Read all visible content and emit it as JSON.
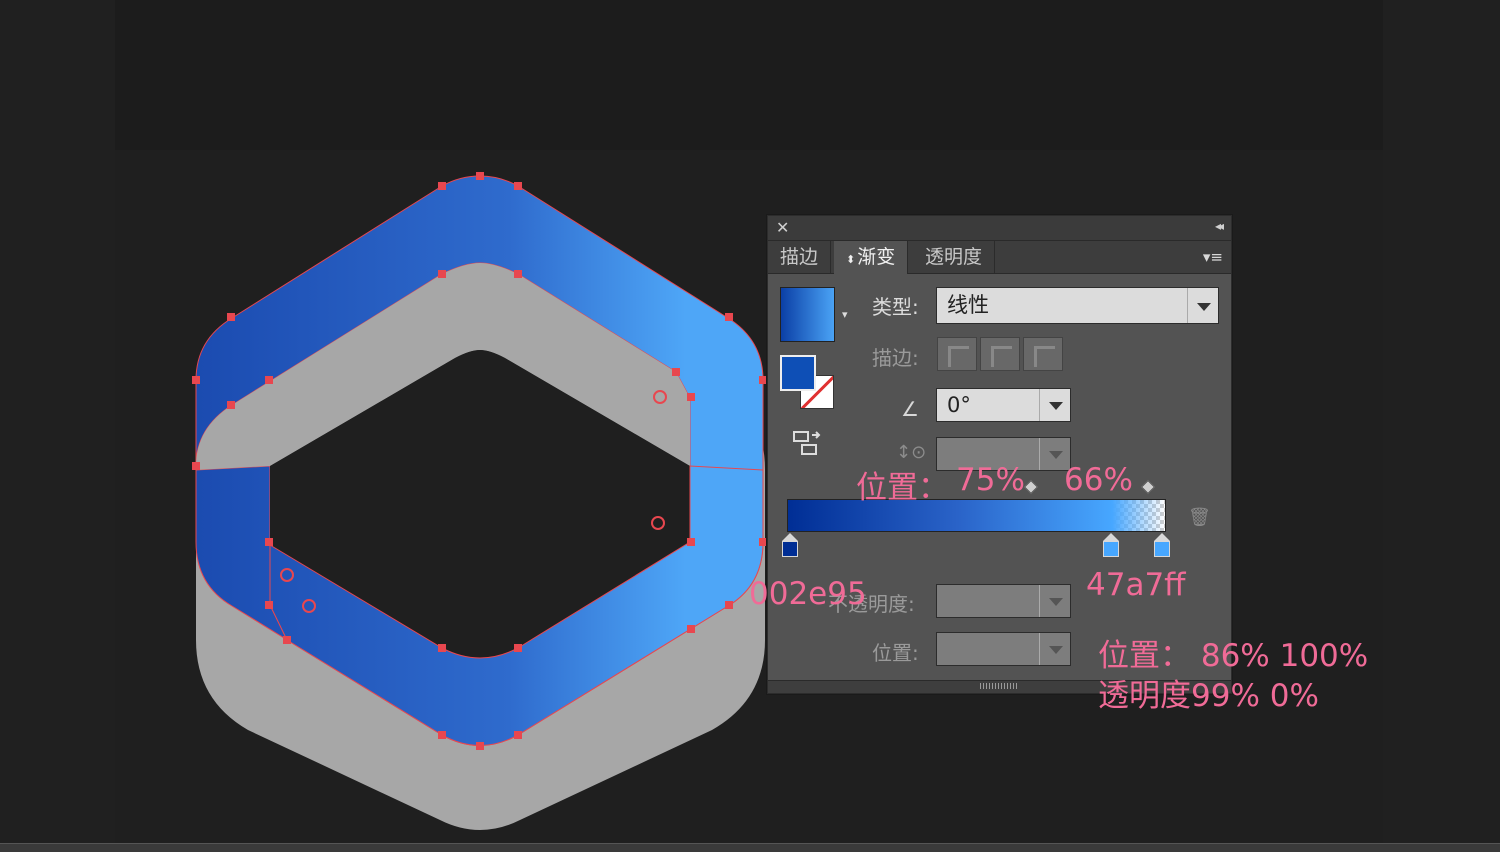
{
  "panel": {
    "tabs": [
      {
        "label": "描边",
        "active": false
      },
      {
        "label": "渐变",
        "active": true
      },
      {
        "label": "透明度",
        "active": false
      }
    ],
    "type_label": "类型:",
    "type_value": "线性",
    "stroke_label": "描边:",
    "angle_value": "0°",
    "opacity_label": "不透明度:",
    "position_label": "位置:"
  },
  "gradient": {
    "stops": [
      {
        "color": "#002e95",
        "location_pct": 0
      },
      {
        "color": "#47a7ff",
        "location_pct": 86
      },
      {
        "color": "#47a7ff",
        "location_pct": 100
      }
    ]
  },
  "annotations": {
    "position_label": "位置：",
    "midpoint_1": "75%",
    "midpoint_2": "66%",
    "color_left": "002e95",
    "color_right": "47a7ff",
    "stop_positions": "位置： 86% 100%",
    "stop_opacity": "透明度99%  0%"
  },
  "colors": {
    "accent_annotation": "#f06b97",
    "anchor_points": "#e8474f",
    "hex_gray": "#a7a7a7",
    "gradient_start": "#002e95",
    "gradient_end": "#47a7ff"
  }
}
